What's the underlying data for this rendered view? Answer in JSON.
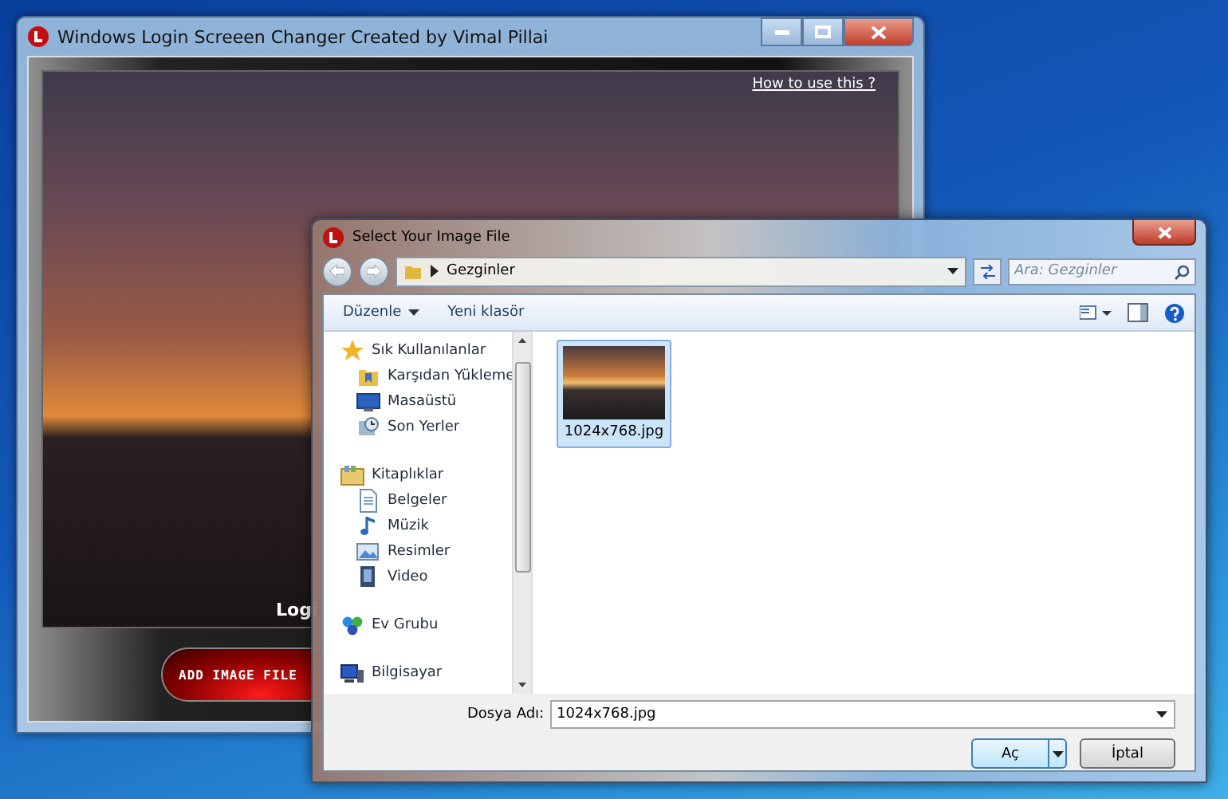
{
  "app_window": {
    "title": "Windows Login Screeen Changer Created by Vimal Pillai",
    "help_link": "How to use this ?",
    "preview_caption": "Logi",
    "add_button": "ADD IMAGE FILE"
  },
  "dialog": {
    "title": "Select Your Image File",
    "breadcrumb": [
      "Gezginler"
    ],
    "search": {
      "placeholder": "Ara: Gezginler"
    },
    "toolbar": [
      {
        "label": "Düzenle",
        "kind": "menu"
      },
      {
        "label": "Yeni klasör",
        "kind": "plain"
      }
    ],
    "nav": [
      {
        "label": "Sık Kullanılanlar",
        "kind": "star",
        "children": [
          {
            "label": "Karşıdan Yükleme",
            "kind": "folder"
          },
          {
            "label": "Masaüstü",
            "kind": "desktop"
          },
          {
            "label": "Son Yerler",
            "kind": "recent"
          }
        ]
      },
      {
        "label": "Kitaplıklar",
        "kind": "library",
        "children": [
          {
            "label": "Belgeler",
            "kind": "document"
          },
          {
            "label": "Müzik",
            "kind": "music"
          },
          {
            "label": "Resimler",
            "kind": "picture"
          },
          {
            "label": "Video",
            "kind": "video"
          }
        ]
      },
      {
        "label": "Ev Grubu",
        "kind": "homegroup"
      },
      {
        "label": "Bilgisayar",
        "kind": "computer"
      }
    ],
    "files": [
      {
        "name": "1024x768.jpg",
        "selected": true
      }
    ],
    "file_name": {
      "label": "Dosya Adı:",
      "value": "1024x768.jpg"
    },
    "buttons": [
      {
        "label": "Aç",
        "kind": "split"
      },
      {
        "label": "İptal",
        "kind": "plain"
      }
    ]
  }
}
